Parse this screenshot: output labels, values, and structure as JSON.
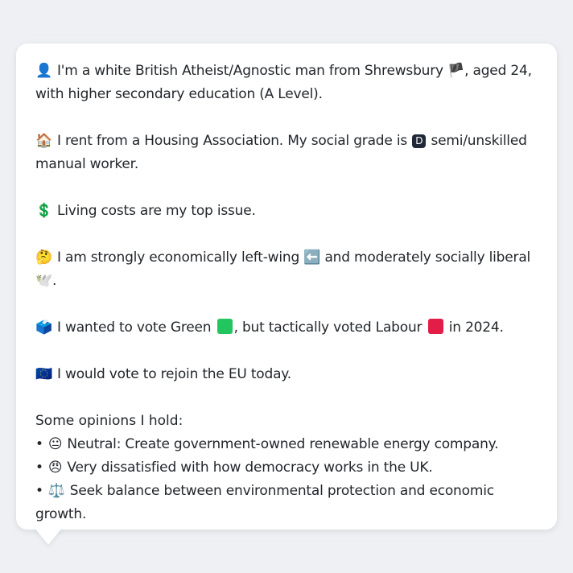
{
  "profile": {
    "intro": {
      "icon": "👤",
      "text_a": "I'm a white British Atheist/Agnostic man from Shrewsbury",
      "flag": "🏴",
      "text_b": ", aged 24, with higher secondary education (A Level)."
    },
    "housing": {
      "icon": "🏠",
      "text_a": "I rent from a Housing Association. My social grade is",
      "grade_badge": "D",
      "text_b": "semi/unskilled manual worker."
    },
    "issue": {
      "icon": "💲",
      "text": "Living costs are my top issue."
    },
    "ideology": {
      "icon": "🤔",
      "text_a": "I am strongly economically left-wing",
      "left_icon": "⬅️",
      "text_b": "and moderately socially liberal",
      "liberal_icon": "🕊️",
      "text_c": "."
    },
    "vote": {
      "icon": "🗳️",
      "text_a": "I wanted to vote Green",
      "green_color": "#22c55e",
      "text_b": ", but tactically voted Labour",
      "red_color": "#e11d48",
      "text_c": "in 2024."
    },
    "eu": {
      "icon": "🇪🇺",
      "text": "I would vote to rejoin the EU today."
    },
    "opinions": {
      "title": "Some opinions I hold:",
      "bullet": "•",
      "items": [
        {
          "icon": "😐",
          "text": "Neutral: Create government-owned renewable energy company."
        },
        {
          "icon": "😠",
          "text": "Very dissatisfied with how democracy works in the UK."
        },
        {
          "icon": "⚖️",
          "text": "Seek balance between environmental protection and economic growth."
        }
      ]
    }
  }
}
